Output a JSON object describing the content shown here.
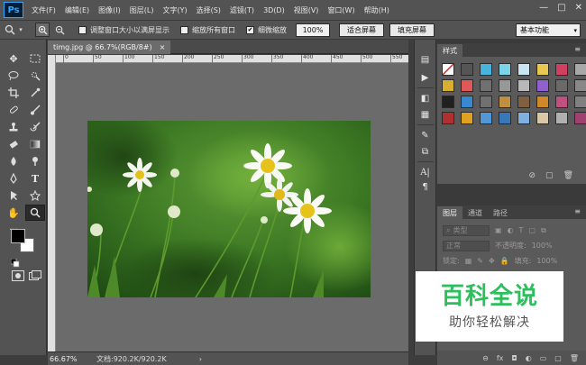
{
  "app": {
    "logo": "Ps",
    "workspace": "基本功能"
  },
  "menu": [
    "文件(F)",
    "编辑(E)",
    "图像(I)",
    "图层(L)",
    "文字(Y)",
    "选择(S)",
    "滤镜(T)",
    "3D(D)",
    "视图(V)",
    "窗口(W)",
    "帮助(H)"
  ],
  "window_controls": {
    "minimize": "—",
    "restore": "□",
    "close": "✕"
  },
  "options": {
    "resize_windows": "调整窗口大小以满屏显示",
    "resize_windows_checked": false,
    "zoom_all_windows": "缩放所有窗口",
    "zoom_all_windows_checked": false,
    "scrubby_zoom": "细微缩放",
    "scrubby_zoom_checked": true,
    "zoom_value": "100%",
    "fit_screen": "适合屏幕",
    "fill_screen": "填充屏幕"
  },
  "document": {
    "tab_title": "timg.jpg @ 66.7%(RGB/8#)",
    "close": "×",
    "ruler_marks": [
      "0",
      "50",
      "100",
      "150",
      "200",
      "250",
      "300",
      "350",
      "400",
      "450",
      "500",
      "550"
    ],
    "zoom_status": "66.67%",
    "doc_info": "文档:920.2K/920.2K",
    "status_arrow": "›"
  },
  "panels": {
    "styles_tab": "样式",
    "layers_tabs": [
      "图层",
      "通道",
      "路径"
    ],
    "layer_kind": "类型",
    "blend_mode": "正常",
    "opacity_label": "不透明度:",
    "opacity_value": "100%",
    "lock_label": "锁定:",
    "fill_label": "填充:",
    "fill_value": "100%",
    "menu_icon": "≡",
    "styles_footer_icons": [
      "⊘",
      "▢",
      "🗑"
    ],
    "layers_footer_icons": [
      "⊖",
      "fx",
      "◘",
      "◐",
      "▭",
      "▢",
      "🗑"
    ]
  },
  "style_colors": [
    "#ffffff",
    "#555555",
    "#46b4dc",
    "#7dd3e8",
    "#c8e6f0",
    "#e8c850",
    "#d04060",
    "#a8a8a8",
    "#d8b030",
    "#e05858",
    "#707070",
    "#989898",
    "#b8b8b8",
    "#9060d0",
    "#6a6a6a",
    "#888888",
    "#202020",
    "#3888d0",
    "#707070",
    "#c09040",
    "#806040",
    "#d08828",
    "#c05080",
    "#808080",
    "#b03030",
    "#e0a020",
    "#5098d8",
    "#3878b8",
    "#80b0e0",
    "#d8c8a8",
    "#b0b0b0",
    "#a04070"
  ],
  "watermark": {
    "title": "百科全说",
    "subtitle": "助你轻松解决"
  }
}
